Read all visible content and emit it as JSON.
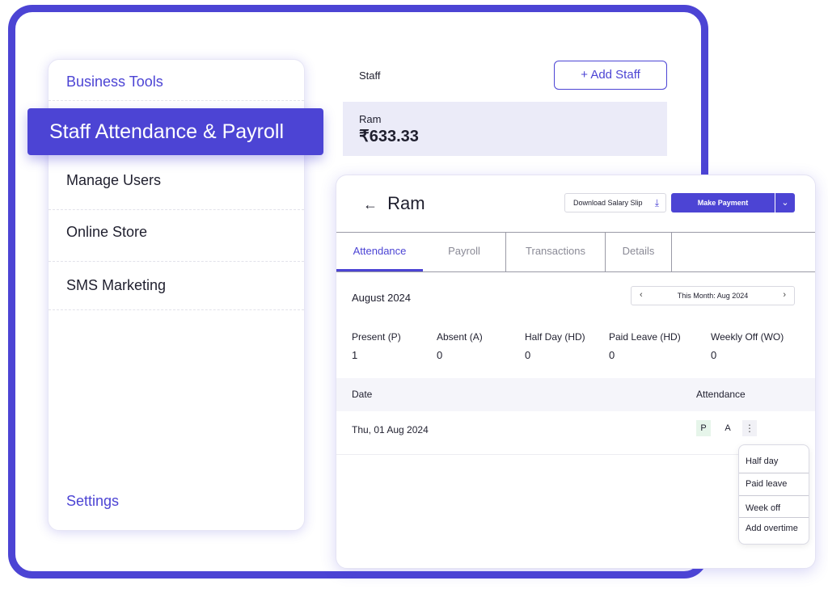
{
  "sidebar": {
    "heading": "Business Tools",
    "active_item": "Staff Attendance & Payroll",
    "items": [
      "Manage Users",
      "Online Store",
      "SMS Marketing"
    ],
    "settings": "Settings"
  },
  "staff_list": {
    "label": "Staff",
    "add_button": "+ Add Staff",
    "card": {
      "name": "Ram",
      "amount": "₹633.33"
    }
  },
  "detail": {
    "back_arrow": "←",
    "name": "Ram",
    "download_button": "Download Salary Slip",
    "download_icon": "⤓",
    "payment_button": "Make Payment",
    "payment_caret": "⌄",
    "tabs": [
      "Attendance",
      "Payroll",
      "Transactions",
      "Details"
    ],
    "month": "August 2024",
    "month_picker": {
      "prev": "‹",
      "label": "This Month:  Aug 2024",
      "next": "›"
    },
    "stats": [
      {
        "label": "Present (P)",
        "value": "1"
      },
      {
        "label": "Absent (A)",
        "value": "0"
      },
      {
        "label": "Half Day (HD)",
        "value": "0"
      },
      {
        "label": "Paid Leave (HD)",
        "value": "0"
      },
      {
        "label": "Weekly Off (WO)",
        "value": "0"
      }
    ],
    "table": {
      "headers": [
        "Date",
        "Attendance"
      ],
      "rows": [
        {
          "date": "Thu, 01 Aug 2024",
          "present": "P",
          "absent": "A",
          "more": "⋮"
        }
      ]
    },
    "menu": [
      "Half day",
      "Paid leave",
      "Week off",
      "Add overtime"
    ]
  },
  "colors": {
    "accent": "#4c44d4",
    "card_bg": "#ebebf8",
    "present_bg": "#e6f5ea"
  },
  "icons": {
    "back": "arrow-left-icon",
    "download": "download-icon",
    "more": "kebab-menu-icon"
  }
}
